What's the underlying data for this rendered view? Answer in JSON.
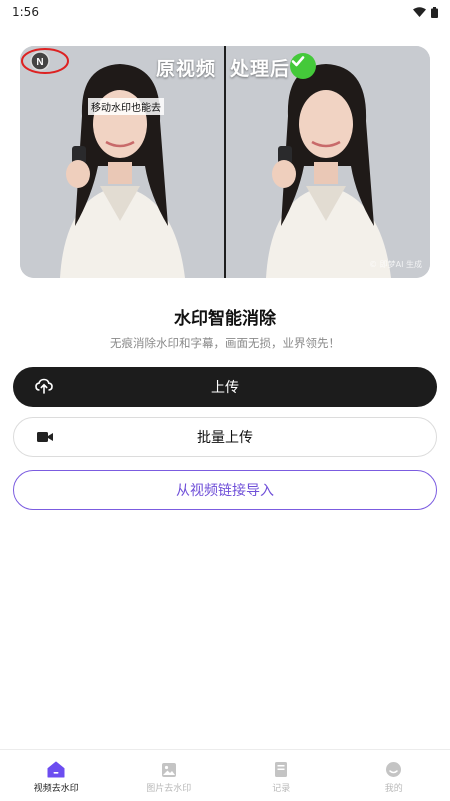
{
  "status_bar": {
    "time": "1:56"
  },
  "hero": {
    "original_label": "原视频",
    "processed_label": "处理后",
    "watermark_caption": "移动水印也能去",
    "corner_mark": "© 即梦AI 生成"
  },
  "headline": "水印智能消除",
  "subline": "无痕消除水印和字幕，画面无损，业界领先！",
  "buttons": {
    "upload": "上传",
    "batch_upload": "批量上传",
    "import_link": "从视频链接导入"
  },
  "tabs": [
    {
      "label": "视频去水印",
      "icon": "home-icon",
      "active": true
    },
    {
      "label": "图片去水印",
      "icon": "image-icon",
      "active": false
    },
    {
      "label": "记录",
      "icon": "record-icon",
      "active": false
    },
    {
      "label": "我的",
      "icon": "profile-icon",
      "active": false
    }
  ],
  "colors": {
    "primary_dark": "#1c1c1c",
    "accent_purple": "#6f4fd8",
    "active_tab": "#6c4df0",
    "check_green": "#44c93a"
  }
}
